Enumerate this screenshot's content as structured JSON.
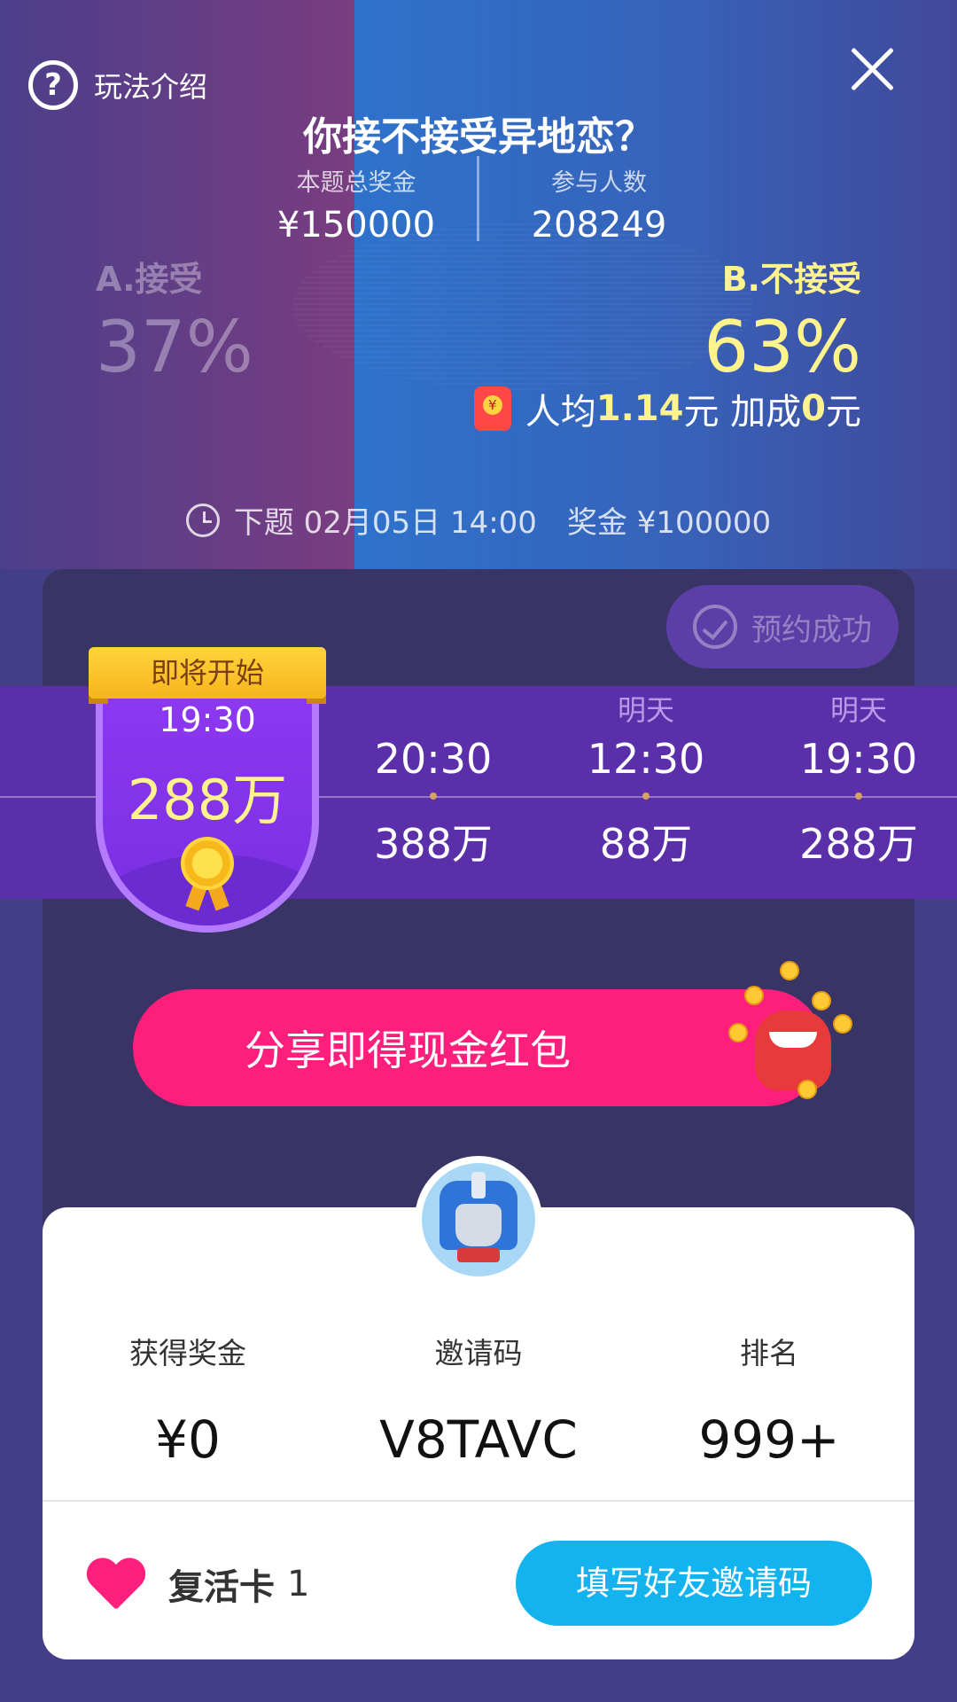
{
  "header": {
    "help_label": "玩法介绍",
    "question": "你接不接受异地恋？"
  },
  "stats": {
    "prize_label": "本题总奖金",
    "prize_value": "¥150000",
    "participants_label": "参与人数",
    "participants_value": "208249"
  },
  "options": {
    "a": {
      "label": "A.接受",
      "percent": "37%"
    },
    "b": {
      "label": "B.不接受",
      "percent": "63%"
    }
  },
  "reward": {
    "prefix": "人均",
    "amount": "1.14",
    "unit1": "元 加成",
    "bonus": "0",
    "unit2": "元"
  },
  "next": {
    "time": "下题 02月05日 14:00",
    "prize": "奖金 ¥100000"
  },
  "schedule": {
    "reserved_label": "预约成功",
    "current": {
      "badge": "即将开始",
      "time": "19:30",
      "prize": "288万"
    },
    "slots": [
      {
        "day": "",
        "time": "20:30",
        "prize": "388万"
      },
      {
        "day": "明天",
        "time": "12:30",
        "prize": "88万"
      },
      {
        "day": "明天",
        "time": "19:30",
        "prize": "288万"
      }
    ]
  },
  "share_label": "分享即得现金红包",
  "user": {
    "earned_label": "获得奖金",
    "earned_value": "¥0",
    "code_label": "邀请码",
    "code_value": "V8TAVC",
    "rank_label": "排名",
    "rank_value": "999+",
    "revive_label": "复活卡",
    "revive_count": "1",
    "invite_label": "填写好友邀请码"
  },
  "colors": {
    "accent_pink": "#fe1f7c",
    "accent_blue": "#13b3f0",
    "highlight_yellow": "#fff38e",
    "band_purple": "#5a2fa9"
  }
}
